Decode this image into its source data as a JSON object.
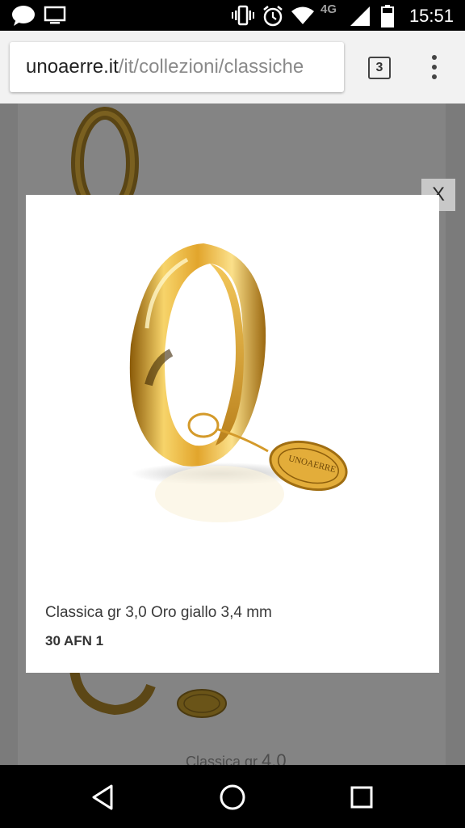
{
  "status_bar": {
    "time": "15:51",
    "network": "4G",
    "icons": [
      "chat-bubble-icon",
      "cast-screen-icon",
      "vibrate-icon",
      "alarm-icon",
      "wifi-icon",
      "signal-icon",
      "battery-icon"
    ]
  },
  "browser": {
    "url_domain": "unoaerre.it",
    "url_path": "/it/collezioni/classiche",
    "tab_count": "3",
    "menu_icon": "overflow-menu-icon"
  },
  "background_page": {
    "caption_small": "Classica gr ",
    "caption_big": "4,0"
  },
  "lightbox": {
    "close_label": "X",
    "title": "Classica gr 3,0 Oro giallo 3,4 mm",
    "code": "30 AFN 1",
    "tag_text": "UNOAERRE"
  },
  "nav_bar": {
    "icons": [
      "back-icon",
      "home-icon",
      "recents-icon"
    ]
  },
  "colors": {
    "gold": "#e0a52a",
    "dim_overlay": "#7b7b7b"
  }
}
